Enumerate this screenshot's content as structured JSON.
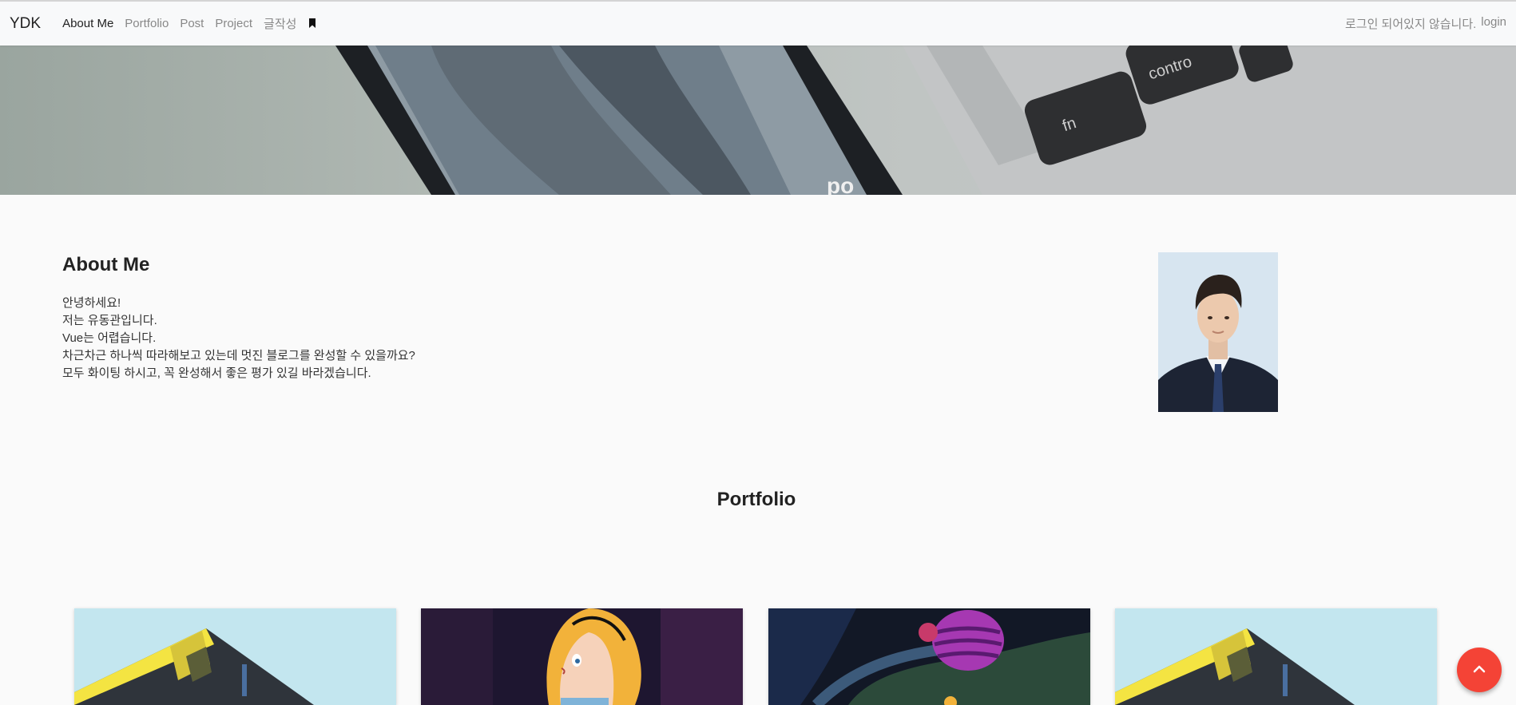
{
  "navbar": {
    "brand": "YDK",
    "links": [
      {
        "label": "About Me",
        "active": true
      },
      {
        "label": "Portfolio",
        "active": false
      },
      {
        "label": "Post",
        "active": false
      },
      {
        "label": "Project",
        "active": false
      },
      {
        "label": "글작성",
        "active": false
      }
    ],
    "bookmark_icon": "bookmark-icon",
    "status_text": "로그인 되어있지 않습니다.",
    "login_label": "login"
  },
  "hero": {
    "key_fn": "fn",
    "key_control": "contro",
    "phone_text": "po"
  },
  "about": {
    "title": "About Me",
    "lines": [
      "안녕하세요!",
      "저는 유동관입니다.",
      "Vue는 어렵습니다.",
      "차근차근 하나씩 따라해보고 있는데 멋진 블로그를 완성할 수 있을까요?",
      "모두 화이팅 하시고, 꼭 완성해서 좋은 평가 있길 바라겠습니다."
    ]
  },
  "portfolio": {
    "title": "Portfolio",
    "cards": [
      {
        "name": "building-image"
      },
      {
        "name": "alice-image"
      },
      {
        "name": "cheshire-cat-image"
      },
      {
        "name": "building-image"
      }
    ]
  },
  "fab": {
    "icon": "chevron-up-icon",
    "color": "#f44336"
  }
}
